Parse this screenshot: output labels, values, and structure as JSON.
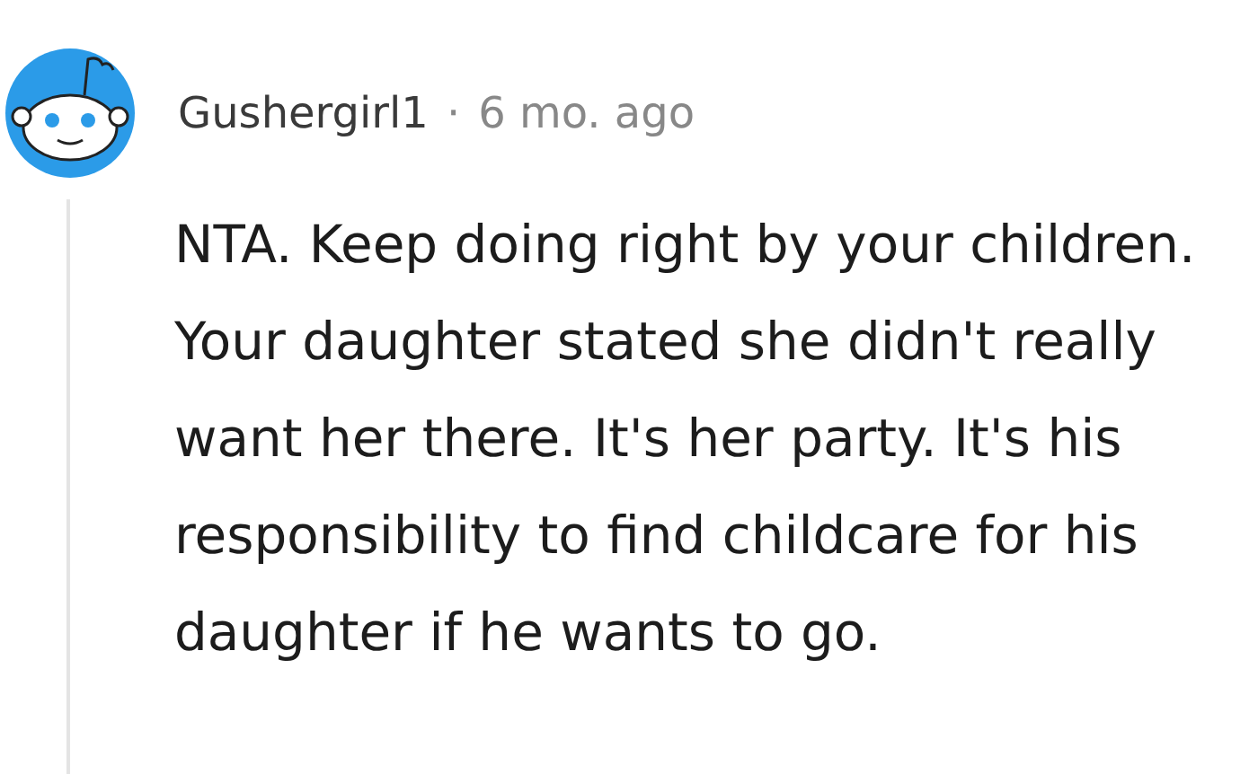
{
  "comment": {
    "author": "Gushergirl1",
    "separator": "·",
    "time": "6 mo. ago",
    "body": "NTA. Keep doing right by your children. Your daughter stated she didn't really want her there. It's her party. It's his responsibility to find childcare for his daughter if he wants to go."
  }
}
